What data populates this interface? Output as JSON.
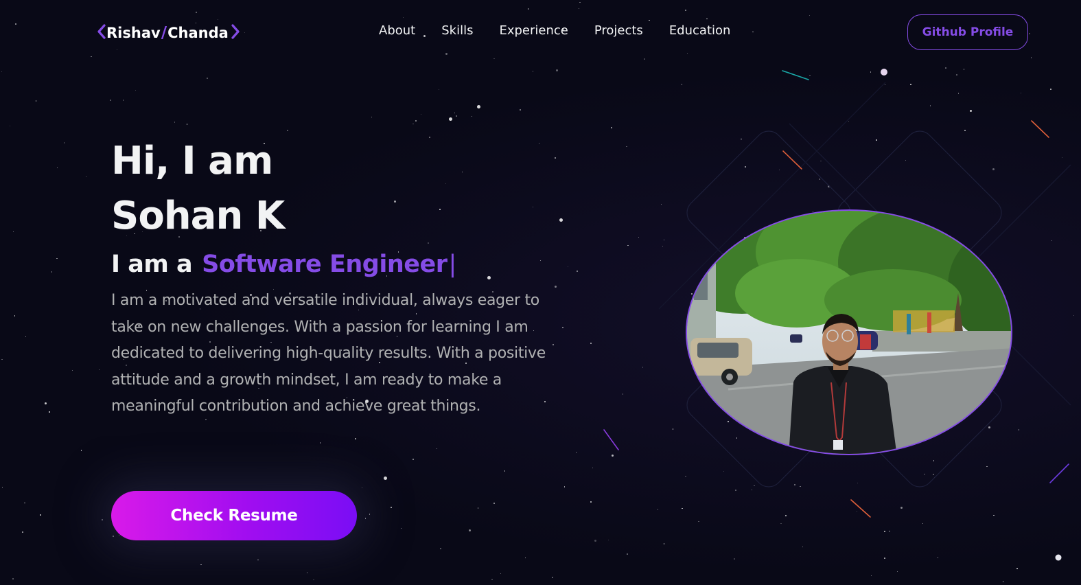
{
  "nav": {
    "logo_first": "Rishav",
    "logo_slash": "/",
    "logo_last": "Chanda",
    "links": [
      "About",
      "Skills",
      "Experience",
      "Projects",
      "Education"
    ],
    "github_label": "Github Profile"
  },
  "hero": {
    "greeting": "Hi, I am",
    "name": "Sohan K",
    "role_prefix": "I am a",
    "role": "Software Engineer",
    "cursor": "|",
    "description": "I am a motivated and versatile individual, always eager to take on new challenges. With a passion for learning I am dedicated to delivering high-quality results. With a positive attitude and a growth mindset, I am ready to make a meaningful contribution and achieve great things.",
    "resume_label": "Check Resume"
  },
  "colors": {
    "background": "#090917",
    "accent": "#854ce6",
    "text_primary": "#f2f3f4",
    "text_secondary": "#b1b2b3",
    "button_gradient_start": "#d91ae9",
    "button_gradient_end": "#7a0df5"
  },
  "icons": {
    "logo_left": "chevron-left-icon",
    "logo_right": "chevron-right-icon"
  }
}
